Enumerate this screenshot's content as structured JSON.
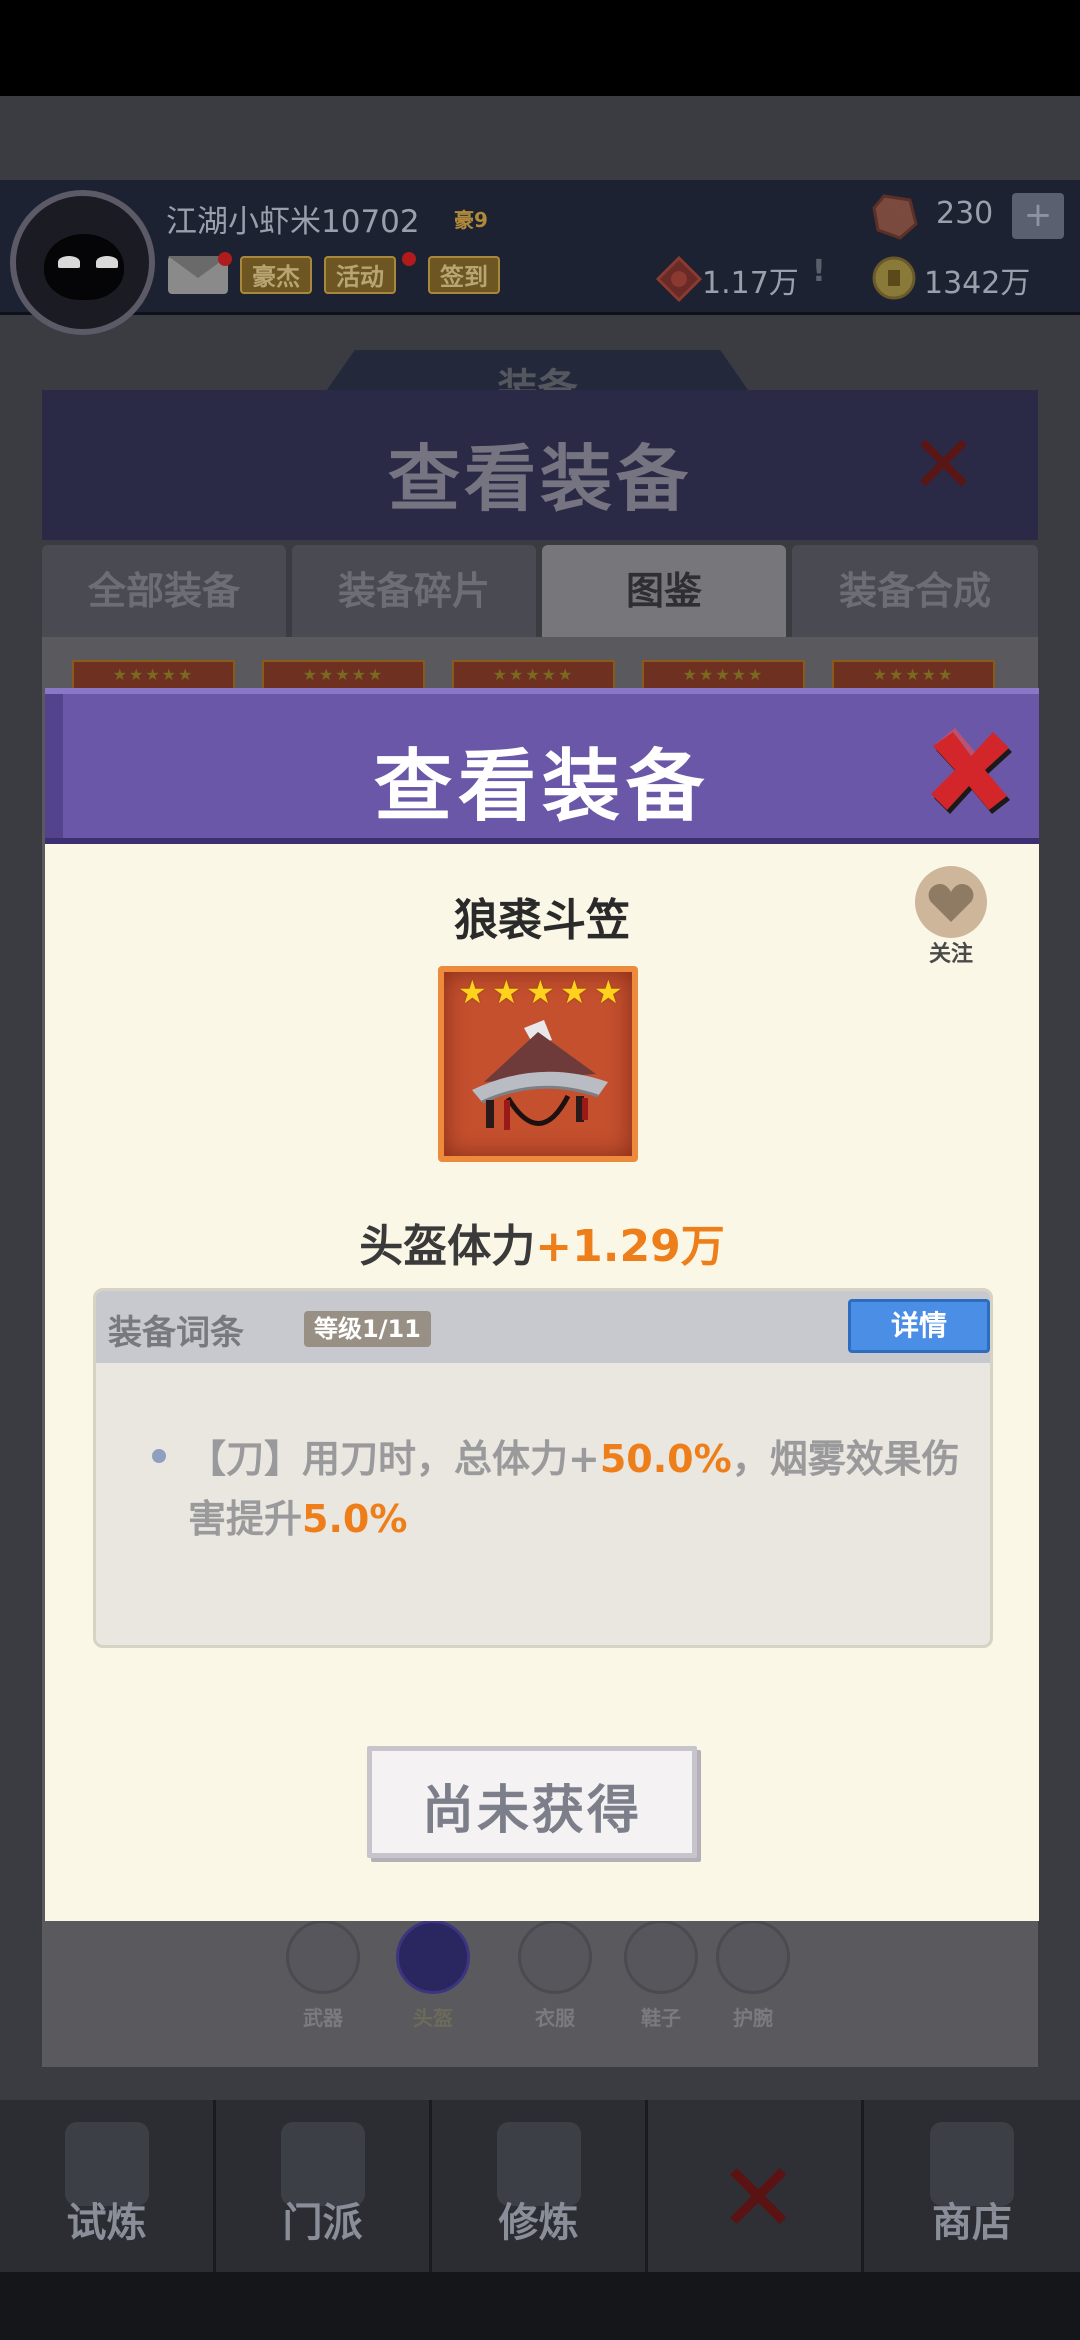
{
  "header": {
    "player_name": "江湖小虾米10702",
    "vip_level": "豪9",
    "tags": [
      "豪杰",
      "活动",
      "签到"
    ],
    "gem_count": "230",
    "plus_label": "+",
    "power_value": "1.17万",
    "power_sep": "!",
    "coin_value": "1342万"
  },
  "background_panel": {
    "section_label": "装备",
    "title": "查看装备",
    "tabs": [
      {
        "label": "全部装备",
        "active": false
      },
      {
        "label": "装备碎片",
        "active": false
      },
      {
        "label": "图鉴",
        "active": true
      },
      {
        "label": "装备合成",
        "active": false
      }
    ],
    "card_stars": "★★★★★",
    "slots": [
      {
        "label": "武器",
        "icon": "sword-icon",
        "active": false
      },
      {
        "label": "头盔",
        "icon": "helmet-icon",
        "active": true
      },
      {
        "label": "衣服",
        "icon": "clothes-icon",
        "active": false
      },
      {
        "label": "鞋子",
        "icon": "shoes-icon",
        "active": false
      },
      {
        "label": "护腕",
        "icon": "bracer-icon",
        "active": false
      }
    ]
  },
  "bottom_nav": [
    {
      "label": "试炼",
      "icon": "ninja-icon"
    },
    {
      "label": "门派",
      "icon": "temple-icon"
    },
    {
      "label": "修炼",
      "icon": "scroll-book-icon"
    },
    {
      "label": "",
      "icon": "close-icon"
    },
    {
      "label": "商店",
      "icon": "shop-icon"
    }
  ],
  "modal": {
    "title": "查看装备",
    "item_name": "狼裘斗笠",
    "follow_label": "关注",
    "star_count": 5,
    "star_glyph": "★",
    "stat_label": "头盔体力",
    "stat_value": "+1.29万",
    "attr_section": {
      "title": "装备词条",
      "level": "等级1/11",
      "detail_button": "详情",
      "text_1": "【刀】用刀时，总体力+",
      "hl_1": "50.0%",
      "text_2": "，烟雾效果伤害提升",
      "hl_2": "5.0%"
    },
    "status_button": "尚未获得"
  },
  "colors": {
    "modal_header": "#6a57a8",
    "modal_body": "#fbf7e6",
    "highlight": "#ee7e1a",
    "detail_button": "#4a8ee6",
    "card_frame": "#ee8a3c"
  }
}
